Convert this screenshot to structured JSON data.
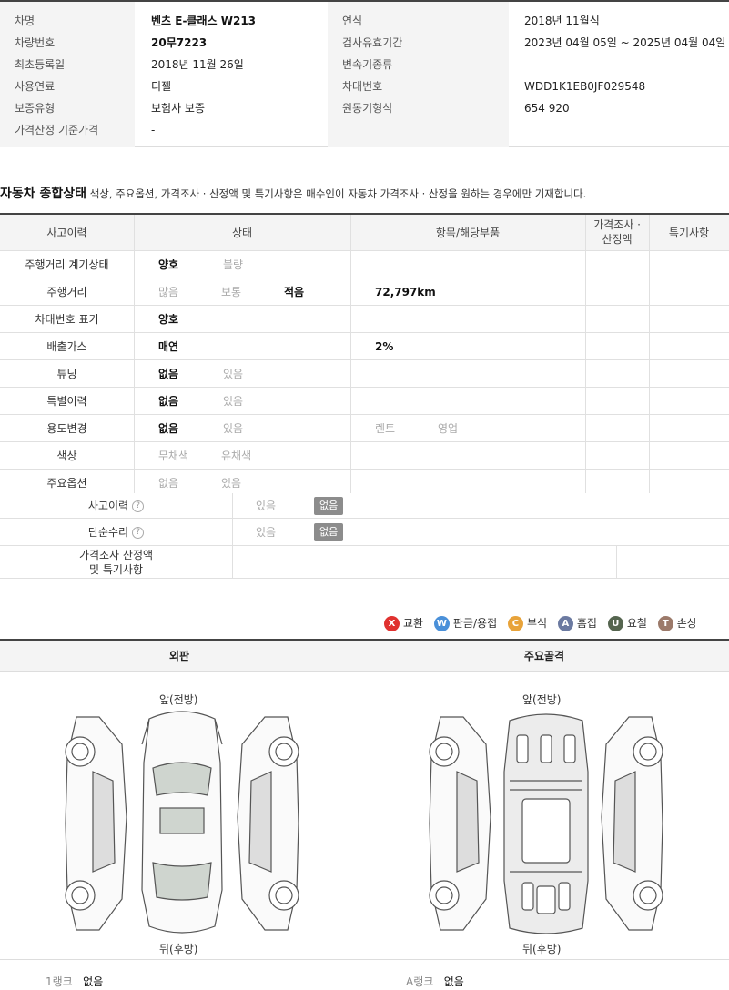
{
  "info": {
    "rows_left": [
      {
        "label": "차명",
        "value": "벤츠   E-클래스 W213"
      },
      {
        "label": "차량번호",
        "value": "20무7223"
      },
      {
        "label": "최초등록일",
        "value": "2018년 11월 26일"
      },
      {
        "label": "사용연료",
        "value": "디젤"
      },
      {
        "label": "보증유형",
        "value": "보험사 보증"
      },
      {
        "label": "가격산정 기준가격",
        "value": "-"
      }
    ],
    "rows_right": [
      {
        "label": "연식",
        "value": "2018년 11월식"
      },
      {
        "label": "검사유효기간",
        "value": "2023년 04월 05일 ~ 2025년 04월 04일"
      },
      {
        "label": "변속기종류",
        "value": ""
      },
      {
        "label": "차대번호",
        "value": "WDD1K1EB0JF029548"
      },
      {
        "label": "원동기형식",
        "value": "654 920"
      }
    ]
  },
  "section": {
    "title": "자동차 종합상태",
    "note": "색상, 주요옵션, 가격조사 · 산정액 및 특기사항은 매수인이 자동차 가격조사 · 산정을 원하는 경우에만 기재합니다."
  },
  "status": {
    "headers": [
      "사고이력",
      "상태",
      "항목/해당부품",
      "가격조사 ·",
      "산정액",
      "특기사항"
    ],
    "rows": [
      {
        "label": "주행거리 계기상태",
        "opts": [
          "양호",
          "불량"
        ],
        "sel": [
          true,
          false
        ],
        "item": "",
        "item2": ""
      },
      {
        "label": "주행거리",
        "opts": [
          "많음",
          "보통",
          "적음"
        ],
        "sel": [
          false,
          false,
          true
        ],
        "item": "72,797km",
        "item2": ""
      },
      {
        "label": "차대번호 표기",
        "opts": [
          "양호"
        ],
        "sel": [
          true
        ],
        "item": "",
        "item2": ""
      },
      {
        "label": "배출가스",
        "opts": [
          "매연"
        ],
        "sel": [
          true
        ],
        "item": "2%",
        "item2": ""
      },
      {
        "label": "튜닝",
        "opts": [
          "없음",
          "있음"
        ],
        "sel": [
          true,
          false
        ],
        "item": "",
        "item2": ""
      },
      {
        "label": "특별이력",
        "opts": [
          "없음",
          "있음"
        ],
        "sel": [
          true,
          false
        ],
        "item": "",
        "item2": ""
      },
      {
        "label": "용도변경",
        "opts": [
          "없음",
          "있음"
        ],
        "sel": [
          true,
          false
        ],
        "item": "렌트",
        "item2": "영업"
      },
      {
        "label": "색상",
        "opts": [
          "무채색",
          "유채색"
        ],
        "sel": [
          false,
          false
        ],
        "item": "",
        "item2": ""
      },
      {
        "label": "주요옵션",
        "opts": [
          "없음",
          "있음"
        ],
        "sel": [
          false,
          false
        ],
        "item": "",
        "item2": ""
      }
    ],
    "accident": {
      "label": "사고이력",
      "yes": "있음",
      "no": "없음"
    },
    "repair": {
      "label": "단순수리",
      "yes": "있음",
      "no": "없음"
    },
    "price_note": {
      "line1": "가격조사 산정액",
      "line2": "및 특기사항"
    }
  },
  "legend": [
    {
      "sym": "X",
      "label": "교환",
      "color": "#e0312f"
    },
    {
      "sym": "W",
      "label": "판금/용접",
      "color": "#4a90d9"
    },
    {
      "sym": "C",
      "label": "부식",
      "color": "#e8a33a"
    },
    {
      "sym": "A",
      "label": "흠집",
      "color": "#6b7aa1"
    },
    {
      "sym": "U",
      "label": "요철",
      "color": "#55654f"
    },
    {
      "sym": "T",
      "label": "손상",
      "color": "#9c7a6a"
    }
  ],
  "diagram": {
    "left": {
      "title": "외판",
      "front": "앞(전방)",
      "rear": "뒤(후방)",
      "rank": "1랭크",
      "rank_val": "없음"
    },
    "right": {
      "title": "주요골격",
      "front": "앞(전방)",
      "rear": "뒤(후방)",
      "rank": "A랭크",
      "rank_val": "없음"
    }
  }
}
